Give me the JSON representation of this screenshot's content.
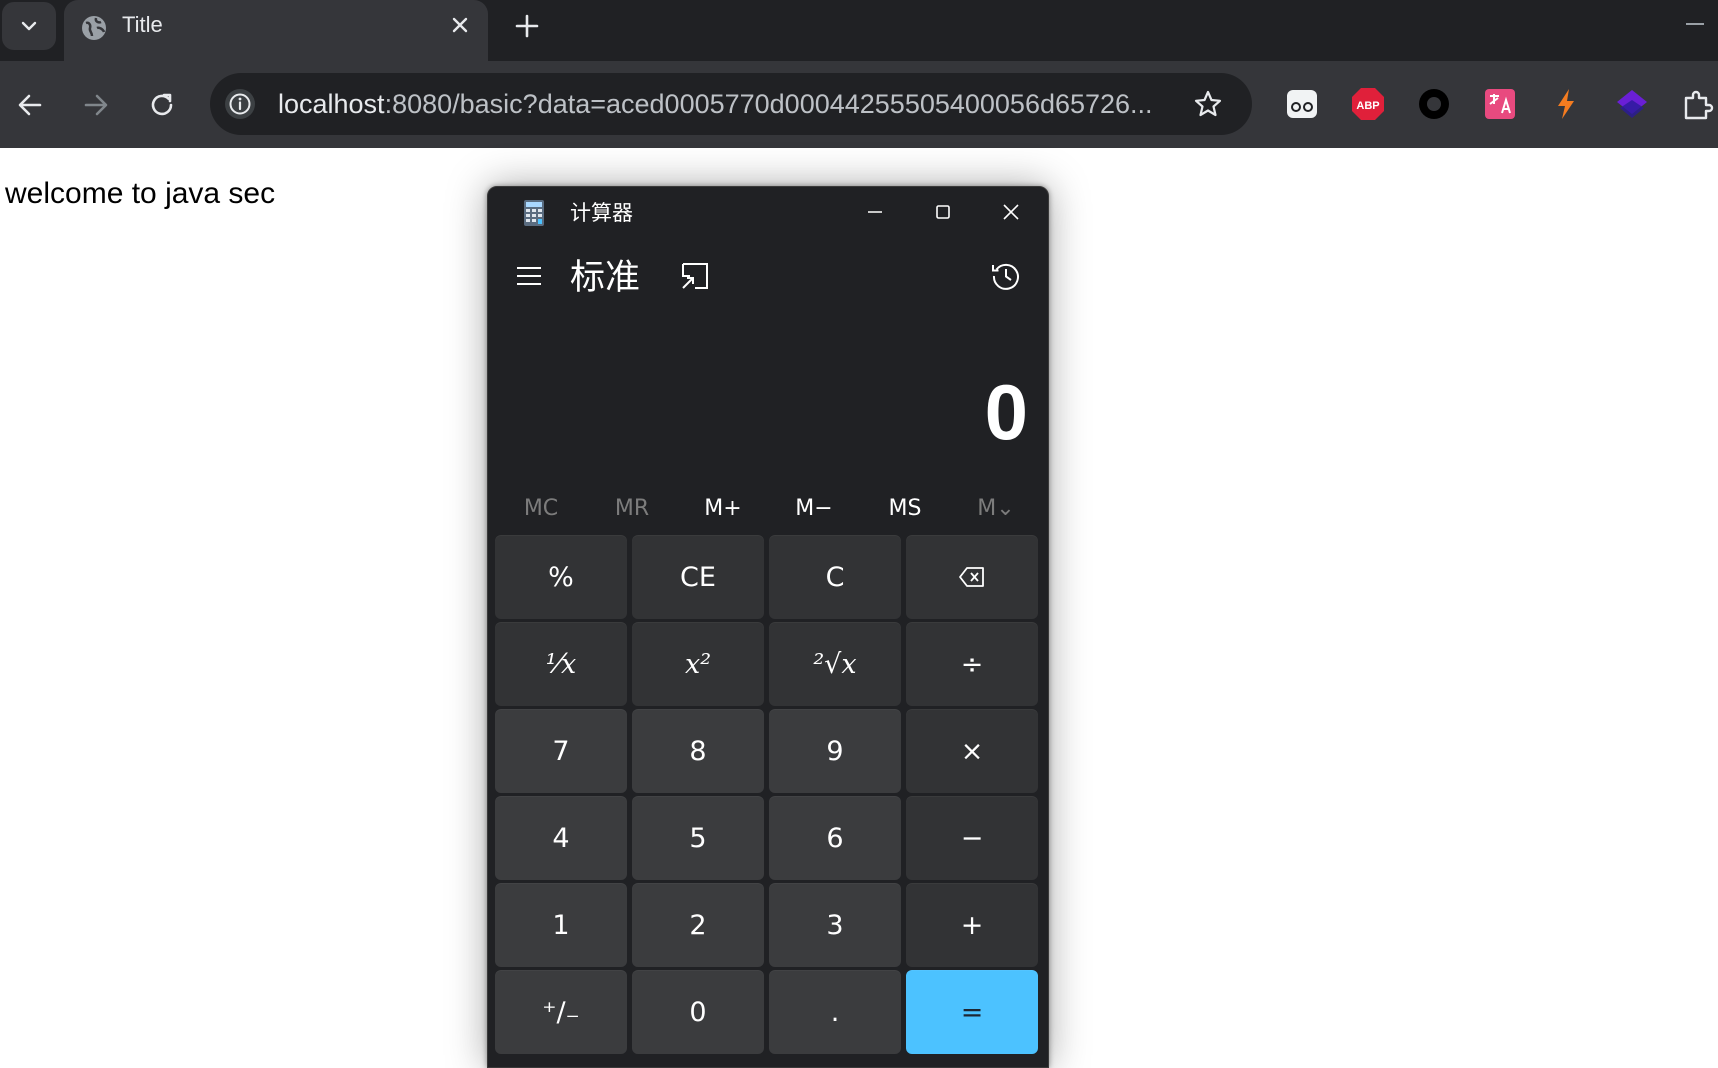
{
  "browser": {
    "tab_title": "Title",
    "url_host": "localhost",
    "url_rest": ":8080/basic?data=aced0005770d00044255505400056d65726...",
    "extensions": [
      "glasses-icon",
      "abp-icon",
      "circle-icon",
      "translate-icon",
      "lightning-icon",
      "layers-icon",
      "puzzle-icon"
    ],
    "abp_label": "ABP"
  },
  "page": {
    "welcome_text": "welcome to java sec"
  },
  "calculator": {
    "window_title": "计算器",
    "mode": "标准",
    "display": "0",
    "memory": [
      {
        "label": "MC",
        "enabled": false
      },
      {
        "label": "MR",
        "enabled": false
      },
      {
        "label": "M+",
        "enabled": true
      },
      {
        "label": "M−",
        "enabled": true
      },
      {
        "label": "MS",
        "enabled": true
      },
      {
        "label": "M⌄",
        "enabled": false
      }
    ],
    "keys": {
      "percent": "%",
      "ce": "CE",
      "c": "C",
      "reciprocal": "¹⁄x",
      "square": "x²",
      "sqrt": "²√x",
      "divide": "÷",
      "seven": "7",
      "eight": "8",
      "nine": "9",
      "multiply": "×",
      "four": "4",
      "five": "5",
      "six": "6",
      "minus": "−",
      "one": "1",
      "two": "2",
      "three": "3",
      "plus": "+",
      "negate": "⁺∕₋",
      "zero": "0",
      "decimal": ".",
      "equals": "="
    },
    "accent_color": "#4cc2ff"
  }
}
